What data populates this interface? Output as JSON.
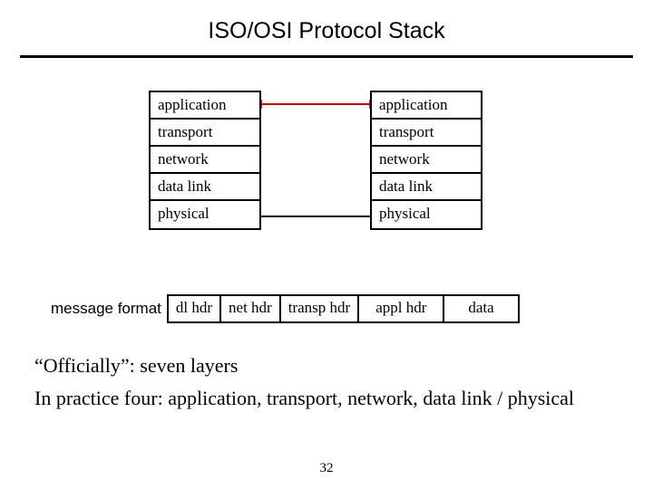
{
  "title": "ISO/OSI Protocol Stack",
  "layers": {
    "l0": "application",
    "l1": "transport",
    "l2": "network",
    "l3": "data link",
    "l4": "physical"
  },
  "message_format": {
    "label": "message format",
    "cells": {
      "c0": "dl hdr",
      "c1": "net hdr",
      "c2": "transp hdr",
      "c3": "appl hdr",
      "c4": "data"
    }
  },
  "body": {
    "line1": "“Officially”: seven layers",
    "line2": "In practice four: application, transport, network, data link / physical"
  },
  "page_number": "32"
}
